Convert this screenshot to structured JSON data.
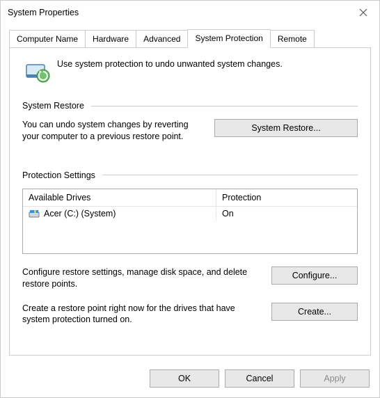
{
  "window": {
    "title": "System Properties"
  },
  "tabs": {
    "computer_name": "Computer Name",
    "hardware": "Hardware",
    "advanced": "Advanced",
    "system_protection": "System Protection",
    "remote": "Remote"
  },
  "intro": "Use system protection to undo unwanted system changes.",
  "sections": {
    "system_restore": {
      "title": "System Restore",
      "description": "You can undo system changes by reverting your computer to a previous restore point.",
      "button": "System Restore..."
    },
    "protection_settings": {
      "title": "Protection Settings",
      "columns": {
        "drives": "Available Drives",
        "protection": "Protection"
      },
      "rows": [
        {
          "name": "Acer (C:) (System)",
          "protection": "On"
        }
      ],
      "configure_text": "Configure restore settings, manage disk space, and delete restore points.",
      "configure_button": "Configure...",
      "create_text": "Create a restore point right now for the drives that have system protection turned on.",
      "create_button": "Create..."
    }
  },
  "footer": {
    "ok": "OK",
    "cancel": "Cancel",
    "apply": "Apply"
  }
}
